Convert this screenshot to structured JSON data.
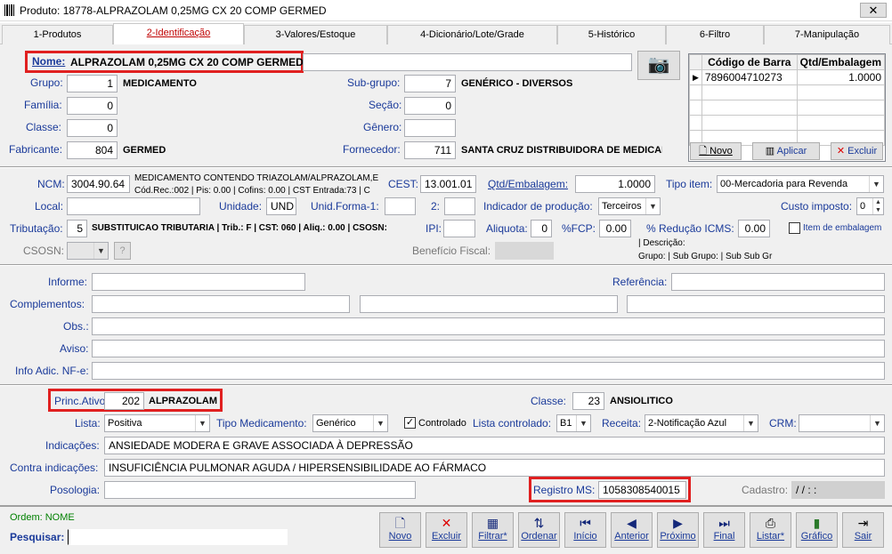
{
  "title": "Produto: 18778-ALPRAZOLAM 0,25MG CX 20 COMP GERMED",
  "tabs": [
    "1-Produtos",
    "2-Identificação",
    "3-Valores/Estoque",
    "4-Dicionário/Lote/Grade",
    "5-Histórico",
    "6-Filtro",
    "7-Manipulação"
  ],
  "ident": {
    "nome_label": "Nome:",
    "nome": "ALPRAZOLAM 0,25MG CX 20 COMP GERMED",
    "grupo_label": "Grupo:",
    "grupo": "1",
    "grupo_desc": "MEDICAMENTO",
    "familia_label": "Família:",
    "familia": "0",
    "classe_label": "Classe:",
    "classe": "0",
    "fabricante_label": "Fabricante:",
    "fabricante": "804",
    "fabricante_desc": "GERMED",
    "subgrupo_label": "Sub-grupo:",
    "subgrupo": "7",
    "subgrupo_desc": "GENÉRICO - DIVERSOS",
    "secao_label": "Seção:",
    "secao": "0",
    "genero_label": "Gênero:",
    "genero": "",
    "fornecedor_label": "Fornecedor:",
    "fornecedor": "711",
    "fornecedor_desc": "SANTA CRUZ  DISTRIBUIDORA DE MEDICAM"
  },
  "barcode": {
    "col1": "Código de Barra",
    "col2": "Qtd/Embalagem",
    "code": "7896004710273",
    "qtd": "1.0000",
    "novo": "Novo",
    "aplicar": "Aplicar",
    "excluir": "Excluir"
  },
  "fiscal": {
    "ncm_label": "NCM:",
    "ncm": "3004.90.64",
    "ncm_desc1": "MEDICAMENTO CONTENDO TRIAZOLAM/ALPRAZOLAM,E",
    "ncm_desc2": "Cód.Rec.:002 | Pis: 0.00 | Cofins: 0.00 | CST Entrada:73 | C",
    "cest_label": "CEST:",
    "cest": "13.001.01",
    "qtdemb_label": "Qtd/Embalagem:",
    "qtdemb": "1.0000",
    "tipoitem_label": "Tipo item:",
    "tipoitem": "00-Mercadoria para Revenda",
    "local_label": "Local:",
    "unidade_label": "Unidade:",
    "unidade": "UND",
    "unidforma_label": "Unid.Forma-1:",
    "dois_label": "2:",
    "indprod_label": "Indicador de produção:",
    "indprod": "Terceiros",
    "custo_label": "Custo imposto:",
    "custo": "0",
    "trib_label": "Tributação:",
    "trib": "5",
    "trib_desc": "SUBSTITUICAO TRIBUTARIA | Trib.: F | CST: 060 | Aliq.:  0.00 | CSOSN:",
    "ipi_label": "IPI:",
    "aliq_label": "Aliquota:",
    "aliq": "0",
    "fcp_label": "%FCP:",
    "fcp": "0.00",
    "redicms_label": "% Redução ICMS:",
    "redicms": "0.00",
    "itememb_label": "Item de embalagem",
    "csosn_label": "CSOSN:",
    "q": "?",
    "benef_label": "Benefício Fiscal:",
    "descricao": "| Descrição:",
    "grupos": "Grupo:  | Sub Grupo:  | Sub Sub Gr"
  },
  "info": {
    "informe_label": "Informe:",
    "referencia_label": "Referência:",
    "complementos_label": "Complementos:",
    "obs_label": "Obs.:",
    "aviso_label": "Aviso:",
    "infoadic_label": "Info Adic. NF-e:"
  },
  "med": {
    "princ_label": "Princ.Ativo",
    "princ": "202",
    "princ_desc": "ALPRAZOLAM",
    "classe_label": "Classe:",
    "classe": "23",
    "classe_desc": "ANSIOLITICO",
    "lista_label": "Lista:",
    "lista": "Positiva",
    "tipomed_label": "Tipo Medicamento:",
    "tipomed": "Genérico",
    "controlado_label": "Controlado",
    "listacontr_label": "Lista controlado:",
    "listacontr": "B1",
    "receita_label": "Receita:",
    "receita": "2-Notificação Azul",
    "crm_label": "CRM:",
    "indic_label": "Indicações:",
    "indic": "ANSIEDADE MODERA E GRAVE ASSOCIADA À DEPRESSÃO",
    "contra_label": "Contra indicações:",
    "contra": "INSUFICIÊNCIA PULMONAR AGUDA / HIPERSENSIBILIDADE AO FÁRMACO",
    "posol_label": "Posologia:",
    "regms_label": "Registro MS:",
    "regms": "1058308540015",
    "cadastro_label": "Cadastro:",
    "cadastro": "/ /      :  :"
  },
  "footer": {
    "ordem": "Ordem: NOME",
    "pesquisar": "Pesquisar:"
  },
  "nav": [
    {
      "label": "Novo",
      "icon": "🗋"
    },
    {
      "label": "Excluir",
      "icon": "✕"
    },
    {
      "label": "Filtrar*",
      "icon": "▦"
    },
    {
      "label": "Ordenar",
      "icon": "⇅"
    },
    {
      "label": "Início",
      "icon": "⏮"
    },
    {
      "label": "Anterior",
      "icon": "◀"
    },
    {
      "label": "Próximo",
      "icon": "▶"
    },
    {
      "label": "Final",
      "icon": "⏭"
    },
    {
      "label": "Listar*",
      "icon": "⎙"
    },
    {
      "label": "Gráfico",
      "icon": "▮"
    },
    {
      "label": "Sair",
      "icon": "⇥"
    }
  ],
  "colors": {
    "accent": "#e02020",
    "label": "#1a3a9a"
  }
}
